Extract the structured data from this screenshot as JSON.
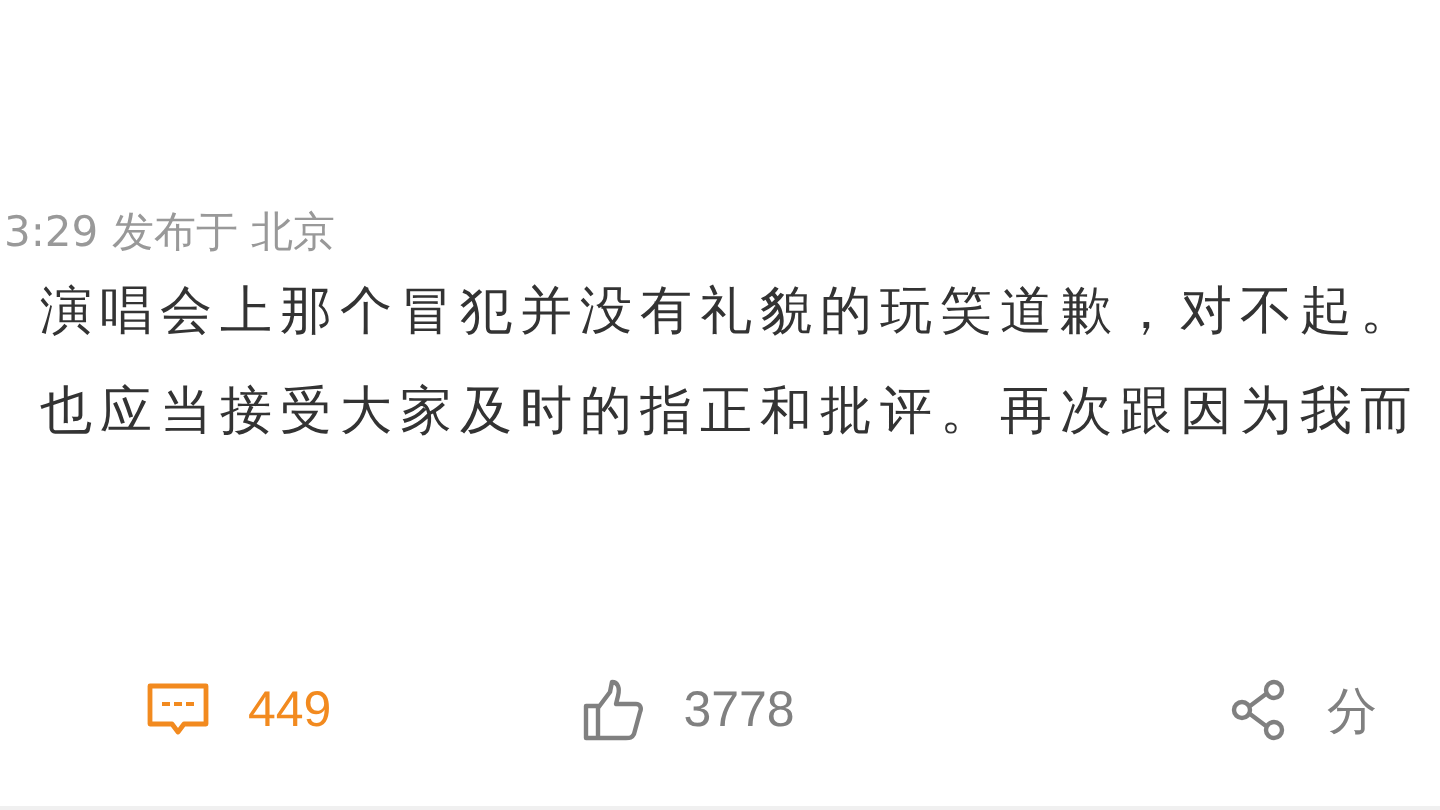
{
  "post": {
    "meta": "3:29 发布于 北京",
    "lines": [
      "演唱会上那个冒犯并没有礼貌的玩笑道歉，对不起。",
      "也应当接受大家及时的指正和批评。再次跟因为我而"
    ]
  },
  "actions": [
    {
      "kind": "comment",
      "count": "449",
      "selected": true
    },
    {
      "kind": "like",
      "count": "3778",
      "selected": false
    },
    {
      "kind": "share",
      "count": "分",
      "selected": false
    }
  ]
}
